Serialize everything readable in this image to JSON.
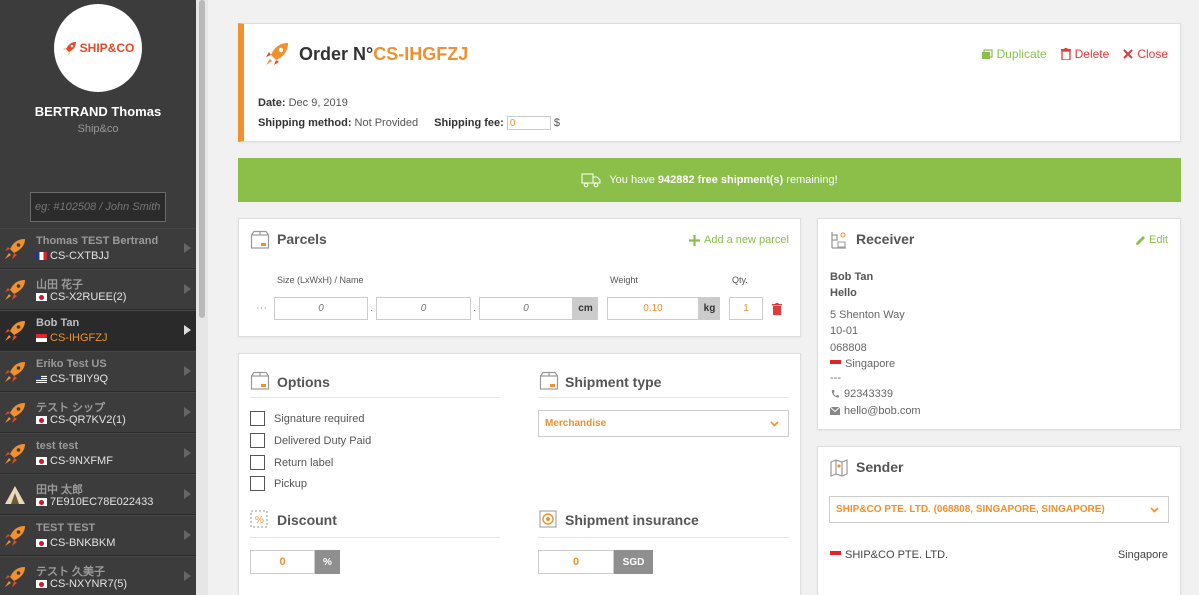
{
  "profile": {
    "logo_text": "SHIP&CO",
    "name": "BERTRAND Thomas",
    "company": "Ship&co"
  },
  "sidebar_search": {
    "placeholder": "eg: #102508 / John Smith"
  },
  "orders": [
    {
      "name": "Thomas TEST Bertrand",
      "ref": "CS-CXTBJJ",
      "flag": "fr",
      "icon": "rocket-icon",
      "active": false
    },
    {
      "name": "山田 花子",
      "ref": "CS-X2RUEE(2)",
      "flag": "jp",
      "icon": "rocket-icon",
      "active": false
    },
    {
      "name": "Bob Tan",
      "ref": "CS-IHGFZJ",
      "flag": "sg",
      "icon": "rocket-icon",
      "active": true
    },
    {
      "name": "Eriko Test US",
      "ref": "CS-TBIY9Q",
      "flag": "us",
      "icon": "rocket-icon",
      "active": false
    },
    {
      "name": "テスト シップ",
      "ref": "CS-QR7KV2(1)",
      "flag": "jp",
      "icon": "rocket-icon",
      "active": false
    },
    {
      "name": "test test",
      "ref": "CS-9NXFMF",
      "flag": "jp",
      "icon": "rocket-icon",
      "active": false
    },
    {
      "name": "田中 太郎",
      "ref": "7E910EC78E022433",
      "flag": "jp",
      "icon": "tent-icon",
      "active": false
    },
    {
      "name": "TEST TEST",
      "ref": "CS-BNKBKM",
      "flag": "jp",
      "icon": "rocket-icon",
      "active": false
    },
    {
      "name": "テスト 久美子",
      "ref": "CS-NXYNR7(5)",
      "flag": "jp",
      "icon": "rocket-icon",
      "active": false
    }
  ],
  "order": {
    "title_prefix": "Order N°",
    "number": "CS-IHGFZJ",
    "duplicate_label": "Duplicate",
    "delete_label": "Delete",
    "close_label": "Close",
    "date_label": "Date:",
    "date_value": "Dec 9, 2019",
    "shipping_method_label": "Shipping method:",
    "shipping_method_value": "Not Provided",
    "shipping_fee_label": "Shipping fee:",
    "shipping_fee_value": "0",
    "currency_symbol": "$"
  },
  "banner": {
    "prefix": "You have",
    "count": "942882 free shipment(s)",
    "suffix": "remaining!"
  },
  "parcels": {
    "title": "Parcels",
    "add_label": "Add a new parcel",
    "size_label": "Size (LxWxH) / Name",
    "weight_label": "Weight",
    "qty_label": "Qty.",
    "handle": "···",
    "length_placeholder": "0",
    "width_placeholder": "0",
    "height_placeholder": "0",
    "dim_sep": "·",
    "dim_unit": "cm",
    "weight_value": "0.10",
    "weight_unit": "kg",
    "qty_value": "1"
  },
  "options": {
    "title": "Options",
    "items": [
      "Signature required",
      "Delivered Duty Paid",
      "Return label",
      "Pickup"
    ]
  },
  "shipment_type": {
    "title": "Shipment type",
    "selected": "Merchandise"
  },
  "discount": {
    "title": "Discount",
    "value": "0",
    "unit": "%"
  },
  "insurance": {
    "title": "Shipment insurance",
    "value": "0",
    "unit": "SGD"
  },
  "receiver": {
    "title": "Receiver",
    "edit_label": "Edit",
    "name": "Bob Tan",
    "company": "Hello",
    "address1": "5 Shenton Way",
    "address2": "10-01",
    "postal": "068808",
    "country": "Singapore",
    "separator": "---",
    "phone": "92343339",
    "email": "hello@bob.com"
  },
  "sender": {
    "title": "Sender",
    "selected": "SHIP&CO PTE. LTD. (068808, SINGAPORE, SINGAPORE)",
    "name": "SHIP&CO PTE. LTD.",
    "country": "Singapore"
  },
  "colors": {
    "accent_orange": "#f0902e",
    "success_green": "#8bbf4a",
    "danger_red": "#e03a3a",
    "sidebar_bg": "#3c3c3c"
  }
}
